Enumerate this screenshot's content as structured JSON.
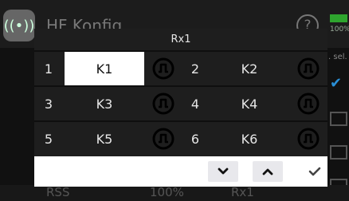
{
  "background": {
    "title": "HF Konfig.",
    "help_symbol": "?",
    "battery_percent": "100%",
    "sel_label": ". sel.",
    "check_mark": "✔",
    "bottom_left": "RSS",
    "bottom_mid": "100%",
    "bottom_right": "Rx1"
  },
  "dialog": {
    "title": "Rx1",
    "channels": [
      {
        "number": "1",
        "label": "K1",
        "selected": true
      },
      {
        "number": "2",
        "label": "K2",
        "selected": false
      },
      {
        "number": "3",
        "label": "K3",
        "selected": false
      },
      {
        "number": "4",
        "label": "K4",
        "selected": false
      },
      {
        "number": "5",
        "label": "K5",
        "selected": false
      },
      {
        "number": "6",
        "label": "K6",
        "selected": false
      }
    ],
    "toolbar": {
      "down_icon": "chevron-down-icon",
      "up_icon": "chevron-up-icon",
      "confirm_icon": "checkmark-icon"
    }
  },
  "colors": {
    "dialog_bg": "#1e1e1e",
    "selected_bg": "#ffffff",
    "battery": "#2ea52e",
    "accent_blue": "#2a8fd6"
  }
}
